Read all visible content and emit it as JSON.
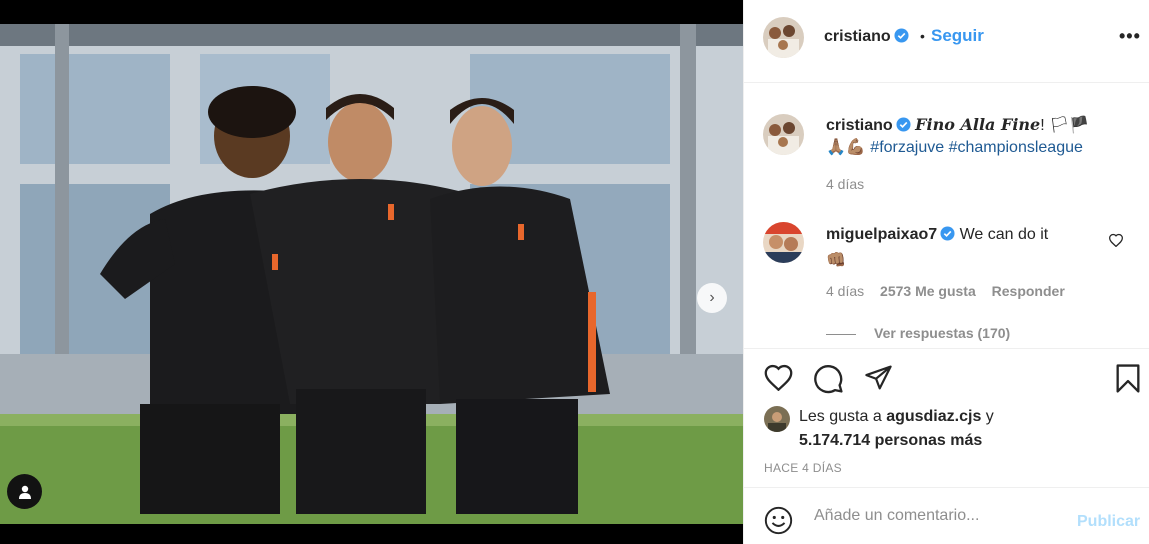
{
  "post": {
    "username": "cristiano",
    "follow_label": "Seguir",
    "separator": "•",
    "more_label": "•••"
  },
  "caption": {
    "username": "cristiano",
    "phrase": "Fino Alla Fine",
    "punct": "! 🏳🏴",
    "emojis": "🙏🏽💪🏽",
    "hashtag1": "#forzajuve",
    "hashtag2": "#championsleague",
    "time": "4 días"
  },
  "comment": {
    "username": "miguelpaixao7",
    "text": "We can do it",
    "emoji": "👊🏽",
    "time": "4 días",
    "likes": "2573 Me gusta",
    "reply": "Responder",
    "view_replies": "Ver respuestas (170)"
  },
  "likes": {
    "prefix": "Les gusta a",
    "user": "agusdiaz.cjs",
    "conj": " y",
    "count": "5.174.714 personas más"
  },
  "posted_ago": "HACE 4 DÍAS",
  "add_comment": {
    "placeholder": "Añade un comentario...",
    "publish": "Publicar"
  },
  "carousel": {
    "total": 2,
    "active": 1
  },
  "colors": {
    "accent": "#3897f0",
    "verified": "#3897f0",
    "hashtag": "#1f5a93",
    "muted": "#8e8e8e"
  }
}
